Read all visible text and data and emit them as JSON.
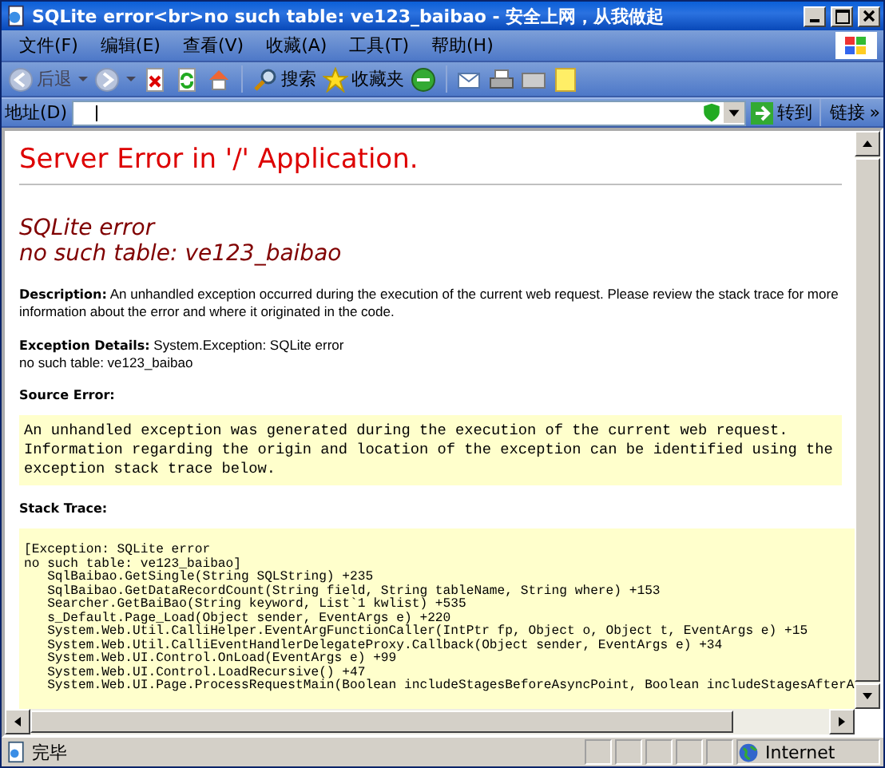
{
  "window": {
    "title": "SQLite error<br>no such table: ve123_baibao - 安全上网，从我做起"
  },
  "menu": [
    "文件(F)",
    "编辑(E)",
    "查看(V)",
    "收藏(A)",
    "工具(T)",
    "帮助(H)"
  ],
  "toolbar": {
    "back": "后退",
    "search": "搜索",
    "favorites": "收藏夹"
  },
  "address_bar": {
    "label": "地址(D)",
    "go": "转到",
    "links": "链接",
    "more": "»"
  },
  "page": {
    "heading": "Server Error in '/' Application.",
    "error_title": "SQLite error\nno such table: ve123_baibao",
    "description": "**Description:** An unhandled exception occurred during the execution of the current web request. Please review the stack trace for more information about the error and where it originated in the code.",
    "exception_details": "**Exception Details:** System.Exception: SQLite error\nno such table: ve123_baibao",
    "source_error_label": "Source Error:",
    "source_error": "An unhandled exception was generated during the execution of the current web request.\nInformation regarding the origin and location of the exception can be identified using the\nexception stack trace below.",
    "stack_trace_label": "Stack Trace:",
    "stack_trace": [
      "[Exception: SQLite error",
      "no such table: ve123_baibao]",
      "   SqlBaibao.GetSingle(String SQLString) +235",
      "   SqlBaibao.GetDataRecordCount(String field, String tableName, String where) +153",
      "   Searcher.GetBaiBao(String keyword, List`1 kwlist) +535",
      "   s_Default.Page_Load(Object sender, EventArgs e) +220",
      "   System.Web.Util.CalliHelper.EventArgFunctionCaller(IntPtr fp, Object o, Object t, EventArgs e) +15",
      "   System.Web.Util.CalliEventHandlerDelegateProxy.Callback(Object sender, EventArgs e) +34",
      "   System.Web.UI.Control.OnLoad(EventArgs e) +99",
      "   System.Web.UI.Control.LoadRecursive() +47",
      "   System.Web.UI.Page.ProcessRequestMain(Boolean includeStagesBeforeAsyncPoint, Boolean includeStagesAfterA"
    ]
  },
  "status_bar": {
    "text": "完毕",
    "zone": "Internet"
  }
}
